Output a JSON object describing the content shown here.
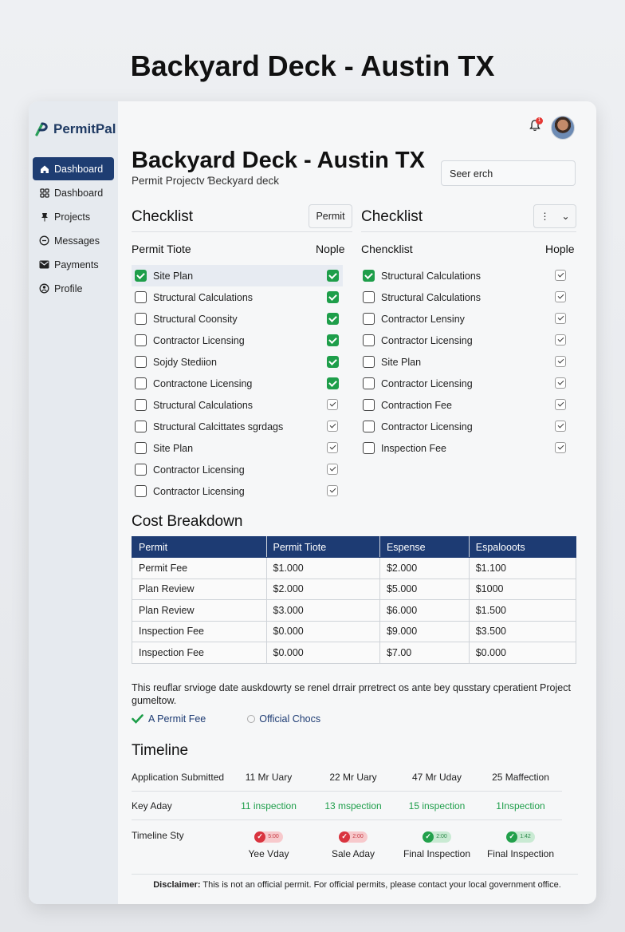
{
  "hero_title": "Backyard Deck - Austin TX",
  "app": {
    "name": "PermitPal",
    "notification_count": "1"
  },
  "sidebar": {
    "items": [
      {
        "label": "Dashboard",
        "icon": "home-icon",
        "active": true
      },
      {
        "label": "Dashboard",
        "icon": "grid-icon",
        "active": false
      },
      {
        "label": "Projects",
        "icon": "pin-icon",
        "active": false
      },
      {
        "label": "Messages",
        "icon": "chat-icon",
        "active": false
      },
      {
        "label": "Payments",
        "icon": "envelope-icon",
        "active": false
      },
      {
        "label": "Profile",
        "icon": "profile-icon",
        "active": false
      }
    ]
  },
  "header": {
    "title": "Backyard Deck - Austin TX",
    "subtitle": "Permit Projectv Ɓeckyard deck",
    "search_placeholder": "Seer erch"
  },
  "checklist_left": {
    "title": "Checklist",
    "button": "Permit",
    "col_name": "Permit Tiote",
    "col_status": "Nople",
    "items": [
      {
        "label": "Site Plan",
        "checked": true,
        "right": "green",
        "highlight": true
      },
      {
        "label": "Structural Calculations",
        "checked": false,
        "right": "green"
      },
      {
        "label": "Structural Coonsity",
        "checked": false,
        "right": "green"
      },
      {
        "label": "Contractor Licensing",
        "checked": false,
        "right": "green"
      },
      {
        "label": "Sojdy Stediion",
        "checked": false,
        "right": "green"
      },
      {
        "label": "Contractone Licensing",
        "checked": false,
        "right": "green"
      },
      {
        "label": "Structural Calculations",
        "checked": false,
        "right": "tick"
      },
      {
        "label": "Structural Calcittates sgrdags",
        "checked": false,
        "right": "tick"
      },
      {
        "label": "Site Plan",
        "checked": false,
        "right": "tick"
      },
      {
        "label": "Contractor Licensing",
        "checked": false,
        "right": "tick"
      },
      {
        "label": "Contractor Licensing",
        "checked": false,
        "right": "tick"
      }
    ]
  },
  "checklist_right": {
    "title": "Checklist",
    "col_name": "Chencklist",
    "col_status": "Hople",
    "items": [
      {
        "label": "Structural Calculations",
        "checked": true
      },
      {
        "label": "Structural Calculations",
        "checked": false
      },
      {
        "label": "Contractor Lensiny",
        "checked": false
      },
      {
        "label": "Contractor Licensing",
        "checked": false
      },
      {
        "label": "Site Plan",
        "checked": false
      },
      {
        "label": "Contractor Licensing",
        "checked": false
      },
      {
        "label": "Contraction Fee",
        "checked": false
      },
      {
        "label": "Contractor Licensing",
        "checked": false
      },
      {
        "label": "Inspection Fee",
        "checked": false
      }
    ]
  },
  "cost": {
    "title": "Cost Breakdown",
    "headers": [
      "Permit",
      "Permit Tiote",
      "Espense",
      "Espalooots"
    ],
    "rows": [
      [
        "Permit Fee",
        "$1.000",
        "$2.000",
        "$1.100"
      ],
      [
        "Plan Review",
        "$2.000",
        "$5.000",
        "$1000"
      ],
      [
        "Plan Review",
        "$3.000",
        "$6.000",
        "$1.500"
      ],
      [
        "Inspection Fee",
        "$0.000",
        "$9.000",
        "$3.500"
      ],
      [
        "Inspection Fee",
        "$0.000",
        "$7.00",
        "$0.000"
      ]
    ]
  },
  "note": {
    "text": "This reuflar srvioge date auskdowrty se renel drrair prretrect os ante bey qusstary cperatient Project gumeltow.",
    "link1": "A Permit Fee",
    "link2": "Official Chocs"
  },
  "timeline": {
    "title": "Timeline",
    "row1": {
      "label": "Application Submitted",
      "cells": [
        "11 Mr Uary",
        "22 Mr Uary",
        "47 Mr Uday",
        "25 Maffection"
      ]
    },
    "row2": {
      "label": "Key Aday",
      "cells": [
        "11 inspection",
        "13 mspection",
        "15 inspection",
        "1Inspection"
      ]
    },
    "row3": {
      "label": "Timeline Sty",
      "pills": [
        {
          "status": "red",
          "text": "5:00"
        },
        {
          "status": "red",
          "text": "2:00"
        },
        {
          "status": "green",
          "text": "2:00"
        },
        {
          "status": "green",
          "text": "1:42"
        }
      ],
      "captions": [
        "Yee Vday",
        "Sale Aday",
        "Final Inspection",
        "Final Inspection"
      ]
    }
  },
  "disclaimer": {
    "bold": "Disclaimer:",
    "text": " This is not an official permit. For official permits, please contact your local government office."
  }
}
